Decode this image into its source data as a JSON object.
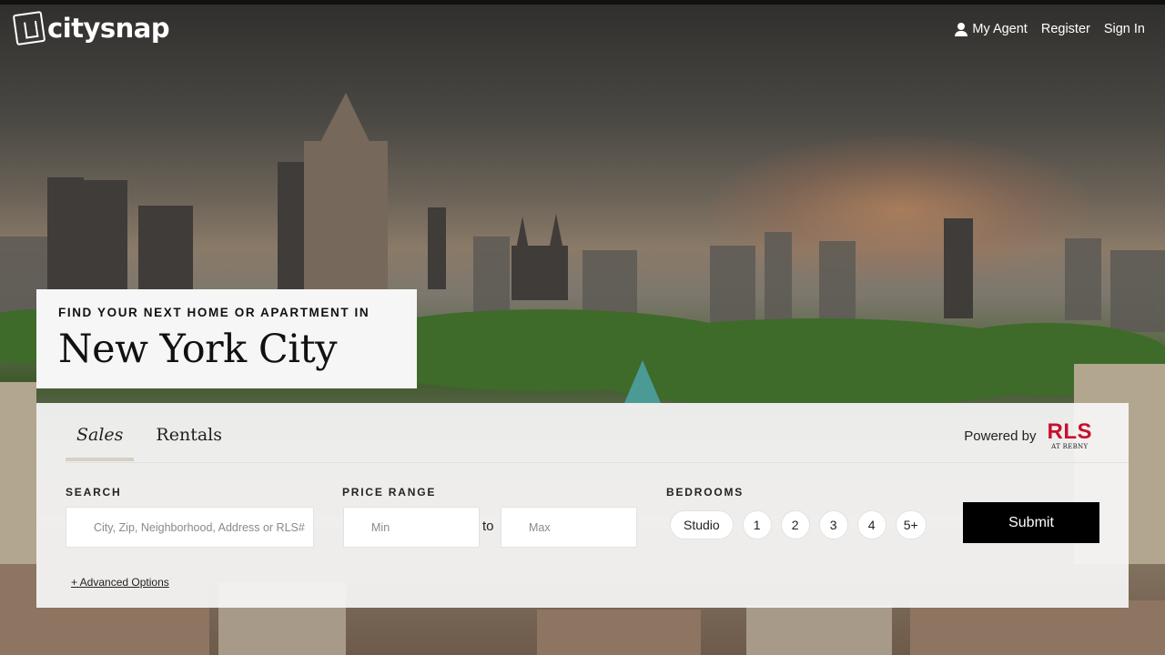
{
  "brand": {
    "name": "citysnap",
    "icon": "citysnap-logo-icon"
  },
  "nav": {
    "my_agent": "My Agent",
    "register": "Register",
    "sign_in": "Sign In",
    "agent_icon": "person-icon"
  },
  "hero": {
    "eyebrow": "FIND YOUR NEXT HOME OR APARTMENT IN",
    "city": "New York City"
  },
  "search_panel": {
    "tabs": [
      {
        "label": "Sales",
        "active": true
      },
      {
        "label": "Rentals",
        "active": false
      }
    ],
    "powered_by": {
      "label": "Powered by",
      "logo_text": "RLS",
      "logo_subtext": "AT REBNY",
      "logo_color": "#c8102e"
    },
    "search": {
      "label": "SEARCH",
      "placeholder": "City, Zip, Neighborhood, Address or RLS#",
      "value": ""
    },
    "price_range": {
      "label": "PRICE RANGE",
      "min_placeholder": "Min",
      "max_placeholder": "Max",
      "separator": "to"
    },
    "bedrooms": {
      "label": "BEDROOMS",
      "options": [
        "Studio",
        "1",
        "2",
        "3",
        "4",
        "5+"
      ]
    },
    "submit_label": "Submit",
    "advanced_options": "+ Advanced Options"
  }
}
